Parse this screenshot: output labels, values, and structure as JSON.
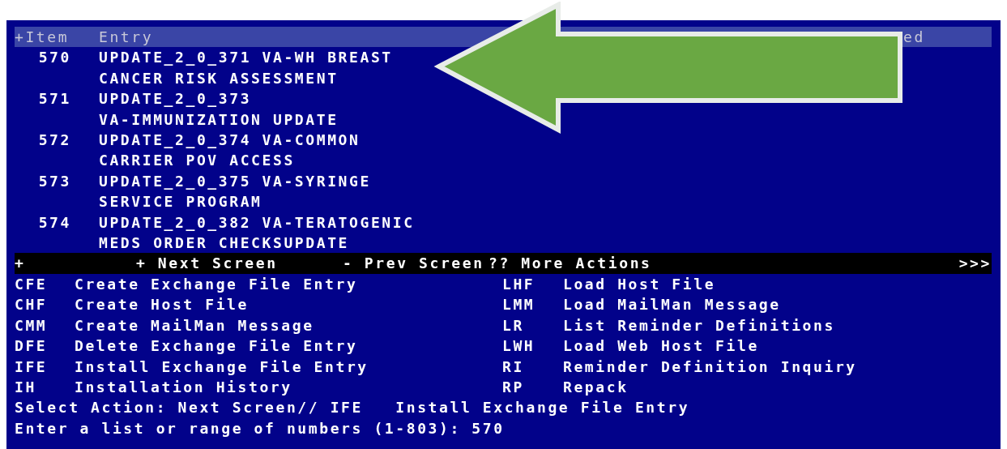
{
  "header": {
    "item": "+Item",
    "entry": "Entry",
    "column_3": "ed"
  },
  "items": [
    {
      "number": "570",
      "lines": [
        "UPDATE_2_0_371 VA-WH BREAST",
        "CANCER RISK ASSESSMENT"
      ]
    },
    {
      "number": "571",
      "lines": [
        "UPDATE_2_0_373",
        "VA-IMMUNIZATION UPDATE"
      ]
    },
    {
      "number": "572",
      "lines": [
        "UPDATE_2_0_374 VA-COMMON",
        "CARRIER POV ACCESS"
      ]
    },
    {
      "number": "573",
      "lines": [
        "UPDATE_2_0_375 VA-SYRINGE",
        "SERVICE PROGRAM"
      ]
    },
    {
      "number": "574",
      "lines": [
        "UPDATE_2_0_382 VA-TERATOGENIC",
        "MEDS ORDER CHECKSUPDATE"
      ]
    }
  ],
  "nav_bar": {
    "marker": "+",
    "commands": [
      "+ Next Screen",
      "- Prev Screen",
      "?? More Actions"
    ],
    "more": ">>>"
  },
  "actions": [
    {
      "code": "CFE",
      "name": "Create Exchange File Entry"
    },
    {
      "code": "LHF",
      "name": "Load Host File"
    },
    {
      "code": "CHF",
      "name": "Create Host File"
    },
    {
      "code": "LMM",
      "name": "Load MailMan Message"
    },
    {
      "code": "CMM",
      "name": "Create MailMan Message"
    },
    {
      "code": "LR",
      "name": "List Reminder Definitions"
    },
    {
      "code": "DFE",
      "name": "Delete Exchange File Entry"
    },
    {
      "code": "LWH",
      "name": "Load Web Host File"
    },
    {
      "code": "IFE",
      "name": "Install Exchange File Entry"
    },
    {
      "code": "RI",
      "name": "Reminder Definition Inquiry"
    },
    {
      "code": "IH",
      "name": "Installation History"
    },
    {
      "code": "RP",
      "name": "Repack"
    }
  ],
  "prompts": [
    "Select Action: Next Screen// IFE   Install Exchange File Entry",
    "Enter a list or range of numbers (1-803): 570"
  ]
}
